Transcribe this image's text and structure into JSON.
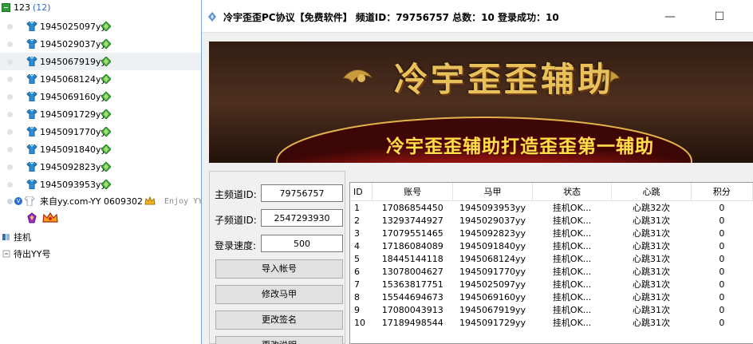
{
  "tree": {
    "group": {
      "name": "123",
      "count": "(12)"
    },
    "users": [
      {
        "name": "1945025097yy"
      },
      {
        "name": "1945029037yy"
      },
      {
        "name": "1945067919yy"
      },
      {
        "name": "1945068124yy"
      },
      {
        "name": "1945069160yy"
      },
      {
        "name": "1945091729yy"
      },
      {
        "name": "1945091770yy"
      },
      {
        "name": "1945091840yy"
      },
      {
        "name": "1945092823yy"
      },
      {
        "name": "1945093953yy"
      }
    ],
    "special_user": {
      "name": "来自yy.com-YY 0609302",
      "signature": "Enjoy YY"
    },
    "section_hang": "挂机",
    "section_exit": "待出YY号"
  },
  "window": {
    "title": "冷宇歪歪PC协议【免费软件】   频道ID：79756757 总数：10 登录成功：10",
    "minimize": "—",
    "maximize": "☐",
    "close": "✕"
  },
  "banner": {
    "title": "冷宇歪歪辅助",
    "subtitle": "冷宇歪歪辅助打造歪歪第一辅助"
  },
  "form": {
    "main_channel_label": "主频道ID:",
    "main_channel_value": "79756757",
    "sub_channel_label": "子频道ID:",
    "sub_channel_value": "2547293930",
    "login_speed_label": "登录速度:",
    "login_speed_value": "500",
    "buttons": [
      "导入帐号",
      "修改马甲",
      "更改签名",
      "更改说明"
    ]
  },
  "table": {
    "columns": [
      "ID",
      "账号",
      "马甲",
      "状态",
      "心跳",
      "积分"
    ],
    "rows": [
      [
        "1",
        "17086854450",
        "1945093953yy",
        "挂机OK...",
        "心跳32次",
        "0"
      ],
      [
        "2",
        "13293744927",
        "1945029037yy",
        "挂机OK...",
        "心跳31次",
        "0"
      ],
      [
        "3",
        "17079551465",
        "1945092823yy",
        "挂机OK...",
        "心跳31次",
        "0"
      ],
      [
        "4",
        "17186084089",
        "1945091840yy",
        "挂机OK...",
        "心跳31次",
        "0"
      ],
      [
        "5",
        "18445144118",
        "1945068124yy",
        "挂机OK...",
        "心跳31次",
        "0"
      ],
      [
        "6",
        "13078004627",
        "1945091770yy",
        "挂机OK...",
        "心跳31次",
        "0"
      ],
      [
        "7",
        "15363817751",
        "1945025097yy",
        "挂机OK...",
        "心跳31次",
        "0"
      ],
      [
        "8",
        "15544694673",
        "1945069160yy",
        "挂机OK...",
        "心跳31次",
        "0"
      ],
      [
        "9",
        "17080043913",
        "1945067919yy",
        "挂机OK...",
        "心跳31次",
        "0"
      ],
      [
        "10",
        "17189498544",
        "1945091729yy",
        "挂机OK...",
        "心跳31次",
        "0"
      ]
    ]
  },
  "colors": {
    "window_border": "#7aa4d6",
    "banner_title": "#e9c15a",
    "banner_subtitle": "#ffe24a",
    "gem_green": "#4caf3d",
    "group_count": "#2b6ad3"
  },
  "icons": [
    "shirt-icon",
    "gem-icon",
    "crown-icon",
    "vip-badge-icon",
    "app-icon",
    "collapse-icon"
  ]
}
